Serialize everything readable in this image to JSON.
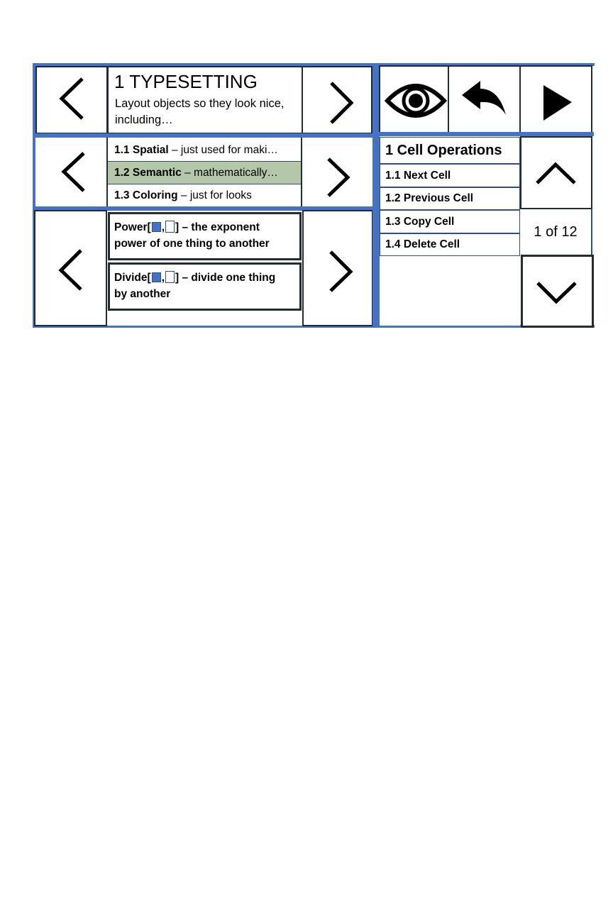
{
  "left_panel": {
    "section": {
      "title": "1 TYPESETTING",
      "description_line1": "Layout objects so they look nice,",
      "description_line2": "including…"
    },
    "subsections": [
      {
        "number": "1.1",
        "name": "Spatial",
        "desc": " – just used for maki…",
        "selected": false
      },
      {
        "number": "1.2",
        "name": "Semantic",
        "desc": " – mathematically…",
        "selected": true
      },
      {
        "number": "1.3",
        "name": "Coloring",
        "desc": " – just for looks",
        "selected": false
      }
    ],
    "functions": [
      {
        "name": "Power[",
        "sep": ",",
        "close": "]",
        "desc_line1": " – the exponent",
        "desc_line2": "power of one thing to another"
      },
      {
        "name": "Divide[",
        "sep": ",",
        "close": "]",
        "desc_line1": " – divide one thing",
        "desc_line2": "by another"
      }
    ]
  },
  "right_panel": {
    "toolbar": {
      "view_icon": "eye-icon",
      "undo_icon": "undo-arrow-icon",
      "run_icon": "play-icon"
    },
    "menu": {
      "title": "1 Cell Operations",
      "items": [
        "1.1 Next Cell",
        "1.2 Previous Cell",
        "1.3 Copy Cell",
        "1.4 Delete Cell"
      ]
    },
    "pager": {
      "label": "1 of 12",
      "up_icon": "chevron-up-icon",
      "down_icon": "chevron-down-icon"
    }
  },
  "colors": {
    "accent_blue": "#4472c4",
    "selected_green": "#b4c7a9",
    "border_dark": "#222a35"
  }
}
